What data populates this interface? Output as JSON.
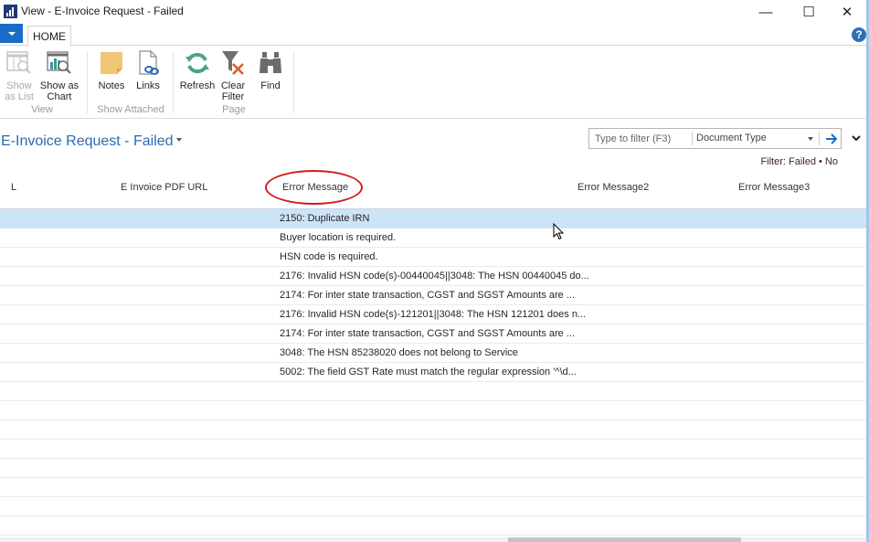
{
  "window": {
    "title": "View - E-Invoice Request - Failed",
    "controls": {
      "minimize": "—",
      "maximize": "☐",
      "close": "✕"
    }
  },
  "ribbon": {
    "tabs": [
      {
        "label": "HOME",
        "active": true
      }
    ],
    "help_icon": "?",
    "groups": [
      {
        "name": "View",
        "buttons": [
          {
            "label_line1": "Show",
            "label_line2": "as List",
            "icon": "list-view-icon",
            "enabled": false
          },
          {
            "label_line1": "Show as",
            "label_line2": "Chart",
            "icon": "chart-view-icon",
            "enabled": true
          }
        ]
      },
      {
        "name": "Show Attached",
        "buttons": [
          {
            "label_line1": "Notes",
            "label_line2": "",
            "icon": "notes-icon",
            "enabled": true
          },
          {
            "label_line1": "Links",
            "label_line2": "",
            "icon": "links-icon",
            "enabled": true
          }
        ]
      },
      {
        "name": "Page",
        "buttons": [
          {
            "label_line1": "Refresh",
            "label_line2": "",
            "icon": "refresh-icon",
            "enabled": true
          },
          {
            "label_line1": "Clear",
            "label_line2": "Filter",
            "icon": "clear-filter-icon",
            "enabled": true
          },
          {
            "label_line1": "Find",
            "label_line2": "",
            "icon": "binoculars-icon",
            "enabled": true
          }
        ]
      }
    ]
  },
  "page": {
    "title": "E-Invoice Request - Failed",
    "filter": {
      "placeholder": "Type to filter (F3)",
      "field": "Document Type",
      "status": "Filter: Failed • No"
    }
  },
  "grid": {
    "columns": [
      "L",
      "E Invoice PDF URL",
      "Error Message",
      "Error Message2",
      "Error Message3"
    ],
    "highlighted_column": "Error Message",
    "rows": [
      {
        "error_message": "2150: Duplicate IRN",
        "selected": true
      },
      {
        "error_message": "Buyer location is required."
      },
      {
        "error_message": "HSN code is required."
      },
      {
        "error_message": "2176: Invalid HSN code(s)-00440045||3048: The HSN 00440045 do..."
      },
      {
        "error_message": "2174: For inter state transaction,  CGST  and SGST  Amounts are ..."
      },
      {
        "error_message": "2176: Invalid HSN code(s)-121201||3048: The HSN 121201 does n..."
      },
      {
        "error_message": "2174: For inter state transaction,  CGST  and SGST  Amounts are ..."
      },
      {
        "error_message": "3048: The HSN 85238020 does not belong to Service"
      },
      {
        "error_message": "5002: The field GST Rate must match the regular expression '^\\d..."
      },
      {
        "error_message": ""
      },
      {
        "error_message": ""
      },
      {
        "error_message": ""
      },
      {
        "error_message": ""
      },
      {
        "error_message": ""
      },
      {
        "error_message": ""
      },
      {
        "error_message": ""
      },
      {
        "error_message": ""
      }
    ]
  },
  "colors": {
    "accent": "#1a6dc6",
    "title_blue": "#2c6bb0",
    "selected_row": "#cce4f7",
    "annotation_red": "#d31a1a"
  }
}
